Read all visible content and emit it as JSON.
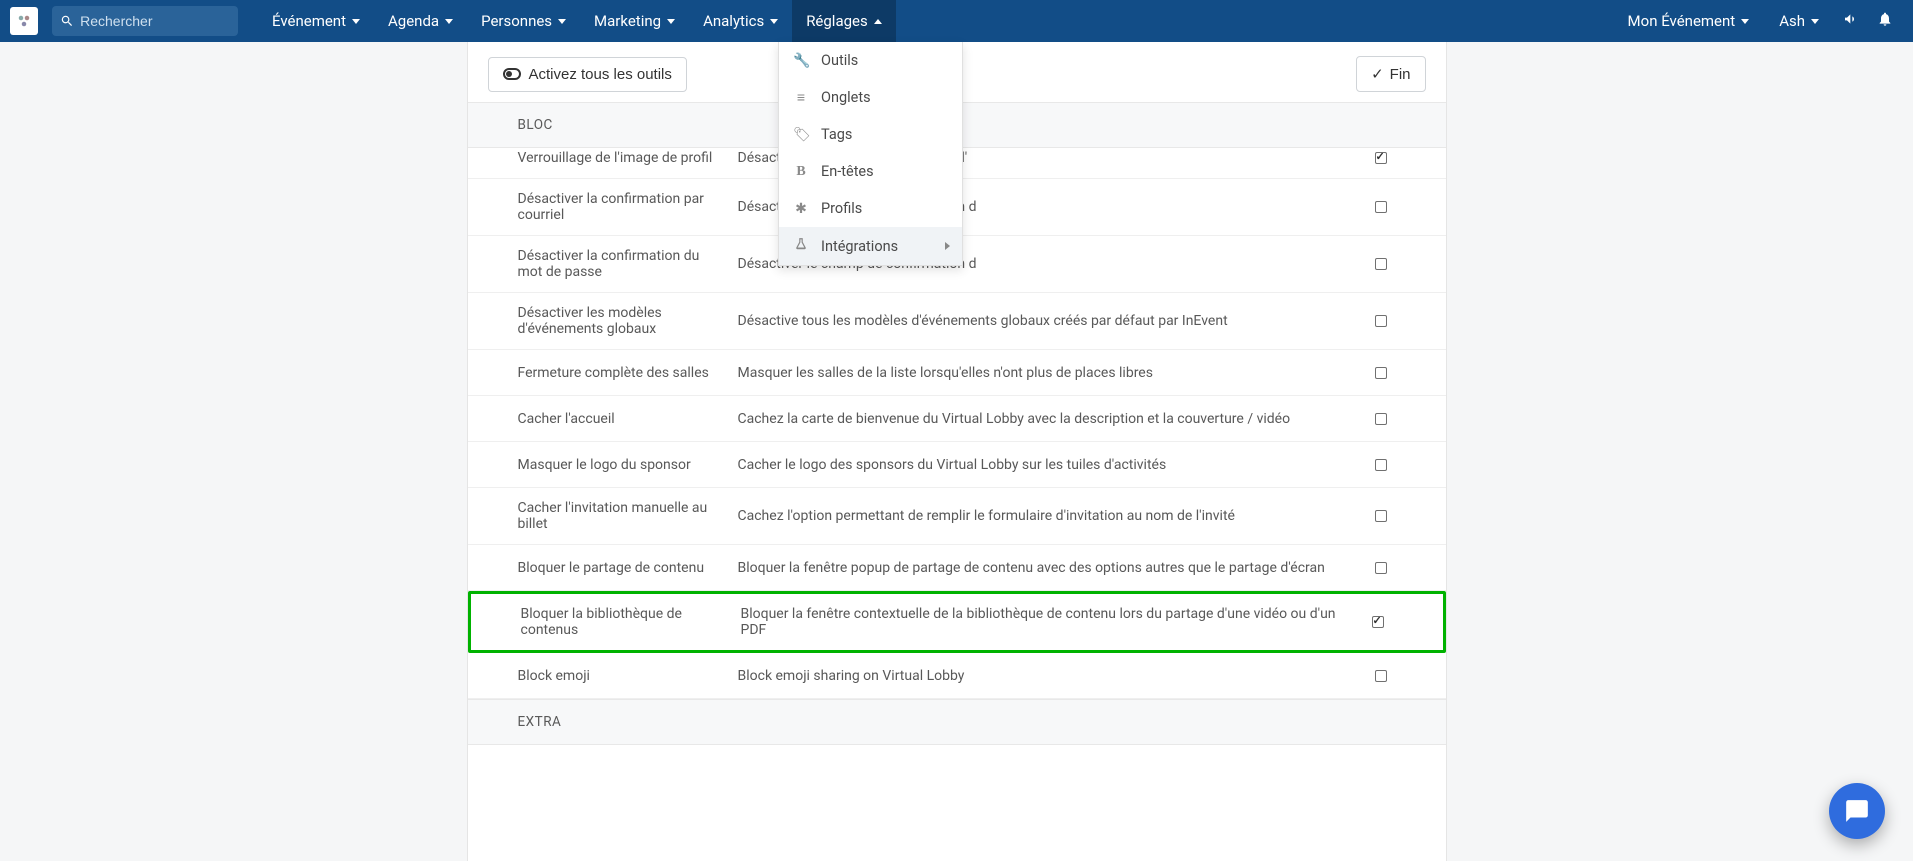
{
  "navbar": {
    "search_placeholder": "Rechercher",
    "items": [
      {
        "label": "Événement"
      },
      {
        "label": "Agenda"
      },
      {
        "label": "Personnes"
      },
      {
        "label": "Marketing"
      },
      {
        "label": "Analytics"
      },
      {
        "label": "Réglages"
      }
    ],
    "right": {
      "my_event": "Mon Événement",
      "user": "Ash"
    }
  },
  "dropdown": {
    "items": [
      {
        "icon": "wrench",
        "label": "Outils"
      },
      {
        "icon": "list",
        "label": "Onglets"
      },
      {
        "icon": "tag",
        "label": "Tags"
      },
      {
        "icon": "bold",
        "label": "En-têtes"
      },
      {
        "icon": "asterisk",
        "label": "Profils"
      },
      {
        "icon": "flask",
        "label": "Intégrations",
        "has_sub": true
      }
    ]
  },
  "actions": {
    "activate_all": "Activez tous les outils",
    "done": "Fin"
  },
  "section1_header": "BLOC",
  "rows": [
    {
      "title": "Verrouillage de l'image de profil",
      "desc": "Désactiver la section du formulaire d'",
      "checked": true,
      "partial_top": true
    },
    {
      "title": "Désactiver la confirmation par courriel",
      "desc": "Désactiver le champ de confirmation d",
      "checked": false
    },
    {
      "title": "Désactiver la confirmation du mot de passe",
      "desc": "Désactiver le champ de confirmation d",
      "checked": false
    },
    {
      "title": "Désactiver les modèles d'événements globaux",
      "desc": "Désactive tous les modèles d'événements globaux créés par défaut par InEvent",
      "checked": false
    },
    {
      "title": "Fermeture complète des salles",
      "desc": "Masquer les salles de la liste lorsqu'elles n'ont plus de places libres",
      "checked": false
    },
    {
      "title": "Cacher l'accueil",
      "desc": "Cachez la carte de bienvenue du Virtual Lobby avec la description et la couverture / vidéo",
      "checked": false
    },
    {
      "title": "Masquer le logo du sponsor",
      "desc": "Cacher le logo des sponsors du Virtual Lobby sur les tuiles d'activités",
      "checked": false
    },
    {
      "title": "Cacher l'invitation manuelle au billet",
      "desc": "Cachez l'option permettant de remplir le formulaire d'invitation au nom de l'invité",
      "checked": false
    },
    {
      "title": "Bloquer le partage de contenu",
      "desc": "Bloquer la fenêtre popup de partage de contenu avec des options autres que le partage d'écran",
      "checked": false
    },
    {
      "title": "Bloquer la bibliothèque de contenus",
      "desc": "Bloquer la fenêtre contextuelle de la bibliothèque de contenu lors du partage d'une vidéo ou d'un PDF",
      "checked": true,
      "highlight": true
    },
    {
      "title": "Block emoji",
      "desc": "Block emoji sharing on Virtual Lobby",
      "checked": false
    }
  ],
  "section2_header": "EXTRA"
}
